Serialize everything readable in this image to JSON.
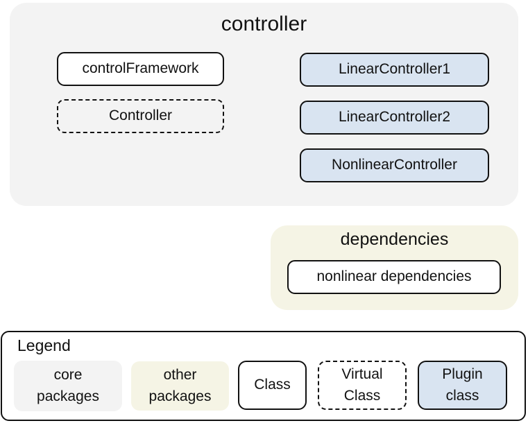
{
  "packages": {
    "controller": {
      "title": "controller",
      "classes": {
        "control_framework": "controlFramework",
        "controller_virtual": "Controller",
        "linear_controller_1": "LinearController1",
        "linear_controller_2": "LinearController2",
        "nonlinear_controller": "NonlinearController"
      }
    },
    "dependencies": {
      "title": "dependencies",
      "classes": {
        "nonlinear_dependencies": "nonlinear dependencies"
      }
    }
  },
  "legend": {
    "title": "Legend",
    "items": [
      {
        "label_line1": "core",
        "label_line2": "packages",
        "kind": "core-package",
        "color": "#f3f3f3"
      },
      {
        "label_line1": "other",
        "label_line2": "packages",
        "kind": "other-package",
        "color": "#f5f4e5"
      },
      {
        "label_line1": "Class",
        "label_line2": "",
        "kind": "class",
        "color": "#ffffff"
      },
      {
        "label_line1": "Virtual",
        "label_line2": "Class",
        "kind": "virtual-class",
        "color": "#ffffff"
      },
      {
        "label_line1": "Plugin",
        "label_line2": "class",
        "kind": "plugin-class",
        "color": "#d9e4f1"
      }
    ]
  },
  "colors": {
    "core_package": "#f3f3f3",
    "other_package": "#f5f4e5",
    "plugin_class": "#d9e4f1",
    "border": "#111111"
  }
}
